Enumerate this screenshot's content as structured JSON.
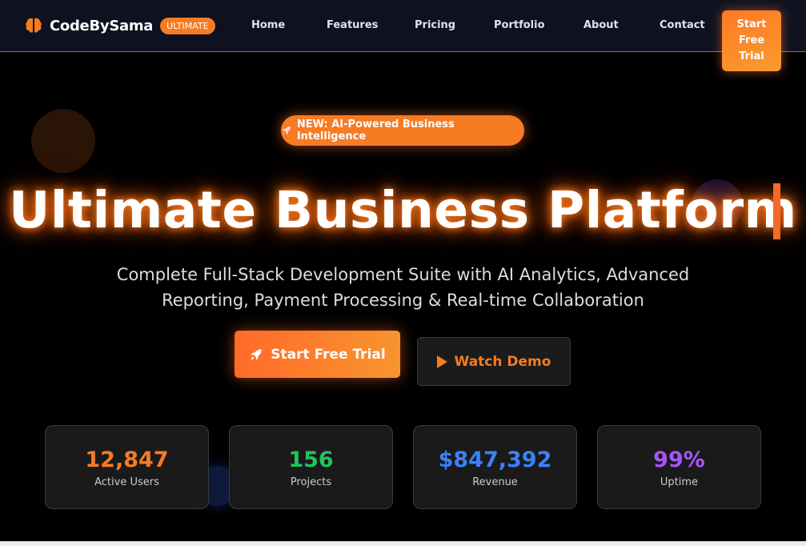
{
  "nav": {
    "brand_name": "CodeBySama",
    "brand_badge": "ULTIMATE",
    "links": [
      "Home",
      "Features",
      "Pricing",
      "Portfolio",
      "About",
      "Contact"
    ],
    "cta_label": "Start Free Trial"
  },
  "hero": {
    "badge_text": "NEW: AI-Powered Business Intelligence",
    "title": "Ultimate Business Platform",
    "subtitle": "Complete Full-Stack Development Suite with AI Analytics, Advanced Reporting, Payment Processing & Real-time Collaboration",
    "primary_button": "Start Free Trial",
    "secondary_button": "Watch Demo"
  },
  "stats": [
    {
      "value": "12,847",
      "label": "Active Users",
      "color": "#f77b23"
    },
    {
      "value": "156",
      "label": "Projects",
      "color": "#21c45c"
    },
    {
      "value": "$847,392",
      "label": "Revenue",
      "color": "#3b82f6"
    },
    {
      "value": "99%",
      "label": "Uptime",
      "color": "#a855f7"
    }
  ],
  "colors": {
    "accent": "#f77b23",
    "background": "#000000",
    "navbar": "#0e1220"
  },
  "icons": {
    "brand": "brain-icon",
    "badge": "rocket-icon",
    "primary_button": "rocket-icon",
    "secondary_button": "play-icon"
  }
}
